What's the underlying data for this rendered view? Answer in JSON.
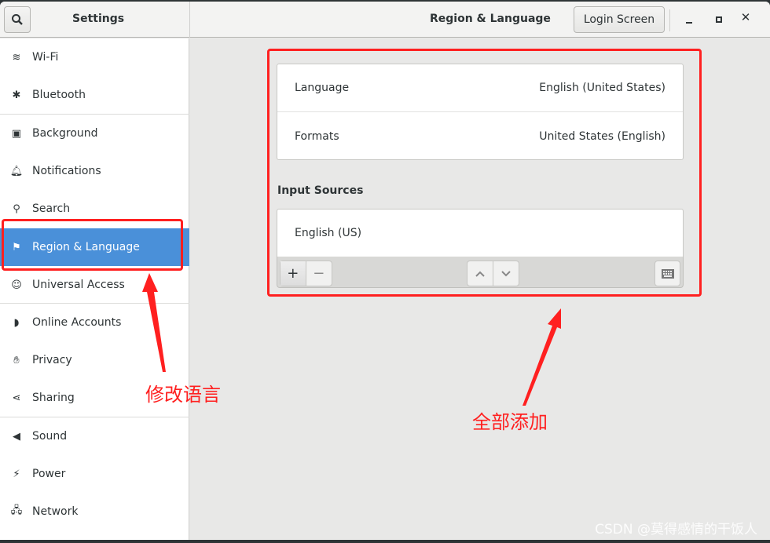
{
  "header": {
    "sidebar_title": "Settings",
    "page_title": "Region & Language",
    "login_screen_label": "Login Screen"
  },
  "sidebar": {
    "items": [
      {
        "label": "Wi-Fi",
        "icon": "wifi-icon"
      },
      {
        "label": "Bluetooth",
        "icon": "bluetooth-icon"
      },
      {
        "label": "Background",
        "icon": "background-icon"
      },
      {
        "label": "Notifications",
        "icon": "bell-icon"
      },
      {
        "label": "Search",
        "icon": "search-icon"
      },
      {
        "label": "Region & Language",
        "icon": "region-flag-icon",
        "selected": true
      },
      {
        "label": "Universal Access",
        "icon": "accessibility-icon"
      },
      {
        "label": "Online Accounts",
        "icon": "online-accounts-icon"
      },
      {
        "label": "Privacy",
        "icon": "hand-icon"
      },
      {
        "label": "Sharing",
        "icon": "share-icon"
      },
      {
        "label": "Sound",
        "icon": "speaker-icon"
      },
      {
        "label": "Power",
        "icon": "power-icon"
      },
      {
        "label": "Network",
        "icon": "network-icon"
      }
    ]
  },
  "main": {
    "language": {
      "label": "Language",
      "value": "English (United States)"
    },
    "formats": {
      "label": "Formats",
      "value": "United States (English)"
    },
    "input_sources_title": "Input Sources",
    "input_sources": [
      "English (US)"
    ],
    "toolbar": {
      "add": "+",
      "remove": "−"
    }
  },
  "annotations": {
    "left": "修改语言",
    "right": "全部添加",
    "color": "#ff2020"
  },
  "watermark": "CSDN @莫得感情的干饭人",
  "colors": {
    "accent": "#4a90d9"
  }
}
